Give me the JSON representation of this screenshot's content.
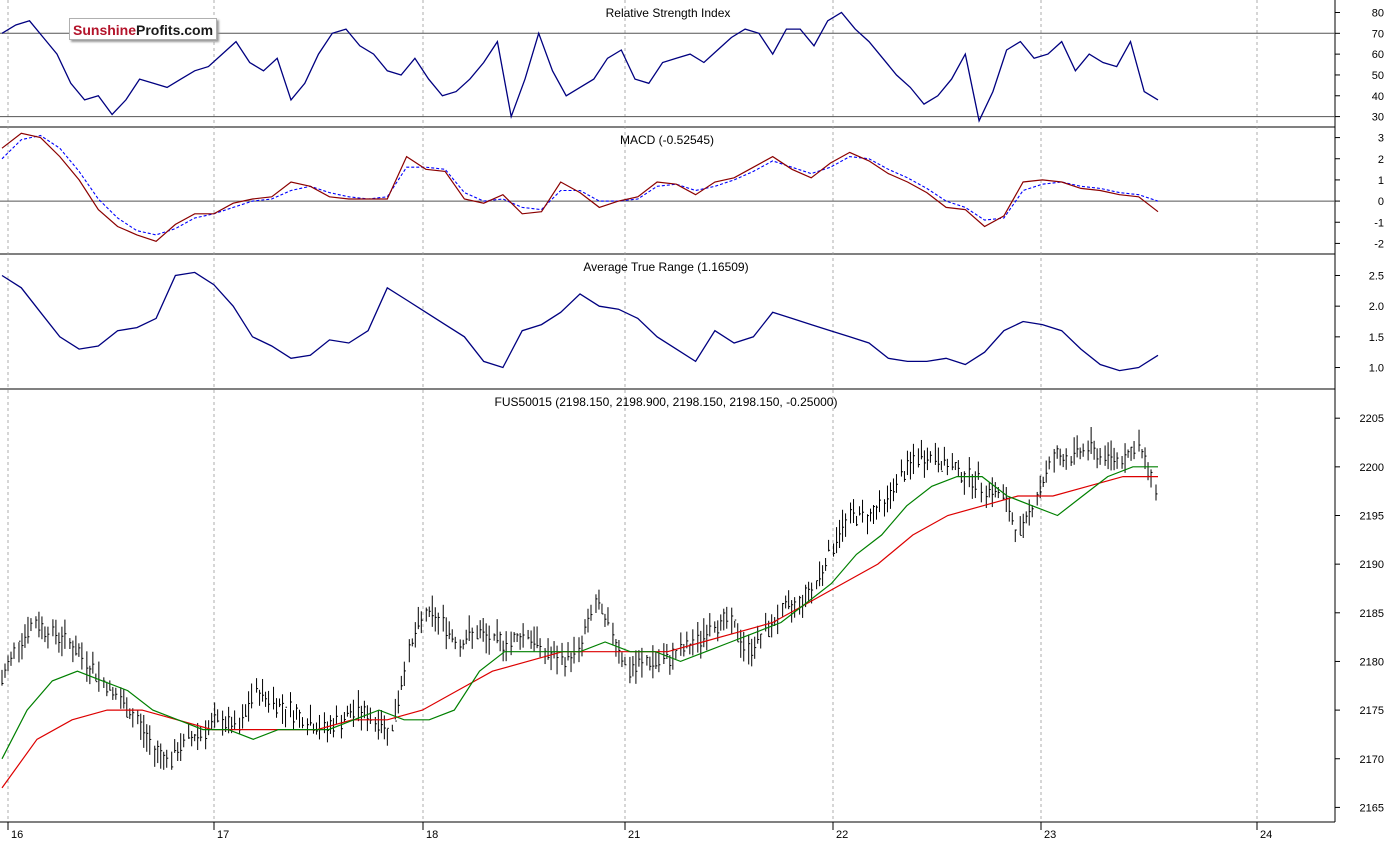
{
  "logo": {
    "part1": "Sunshine",
    "part2": "Profits.com"
  },
  "colors": {
    "rsi": "#000080",
    "macd": "#8b0000",
    "signal": "#0000ff",
    "atr": "#000080",
    "sma_fast": "#008000",
    "sma_slow": "#dd0000",
    "grid": "#999999",
    "bars": "#000000"
  },
  "chart_data": [
    {
      "type": "line",
      "title": "Relative Strength Index",
      "ylim": [
        25,
        86
      ],
      "yticks": [
        30,
        40,
        50,
        60,
        70,
        80
      ],
      "reference_lines": [
        30,
        70
      ],
      "x": [
        0,
        2,
        4,
        6,
        8,
        10,
        12,
        14,
        16,
        18,
        20,
        22,
        24,
        26,
        28,
        30,
        32,
        34,
        36,
        38,
        40,
        42,
        44,
        46,
        48,
        50,
        52,
        54,
        56,
        58,
        60,
        62,
        64,
        66,
        68,
        70,
        72,
        74,
        76,
        78,
        80,
        82,
        84,
        86,
        88,
        90,
        92,
        94,
        96,
        98,
        100,
        102,
        104,
        106,
        108,
        110,
        112,
        114,
        116,
        118,
        120,
        122,
        124,
        126,
        128,
        130,
        132,
        134,
        136,
        138
      ],
      "series": [
        {
          "values": [
            70,
            74,
            76,
            68,
            60,
            46,
            38,
            40,
            31,
            38,
            48,
            46,
            44,
            48,
            52,
            54,
            60,
            66,
            56,
            52,
            58,
            38,
            46,
            60,
            70,
            72,
            64,
            60,
            52,
            50,
            58,
            48,
            40,
            42,
            48,
            56,
            66,
            30,
            48,
            70,
            52,
            40,
            44,
            48,
            58,
            62,
            48,
            46,
            56,
            58,
            60,
            56,
            62,
            68,
            72,
            70,
            60,
            72,
            72,
            64,
            76,
            80,
            72,
            66,
            58,
            50,
            44,
            36,
            40,
            48,
            60,
            28,
            42,
            62,
            66,
            58,
            60,
            66,
            52,
            60,
            56,
            54,
            66,
            42,
            38
          ]
        }
      ]
    },
    {
      "type": "line",
      "title": "MACD (-0.52545)",
      "ylim": [
        -2.5,
        3.5
      ],
      "yticks": [
        -2,
        -1,
        0,
        1,
        2,
        3
      ],
      "reference_lines": [
        0
      ],
      "x": [
        0,
        2,
        4,
        6,
        8,
        10,
        12,
        14,
        16,
        18,
        20,
        22,
        24,
        26,
        28,
        30,
        32,
        34,
        36,
        38,
        40,
        42,
        44,
        46,
        48,
        50,
        52,
        54,
        56,
        58,
        60,
        62,
        64,
        66,
        68,
        70,
        72,
        74,
        76,
        78,
        80,
        82,
        84,
        86,
        88,
        90,
        92,
        94,
        96,
        98,
        100,
        102,
        104,
        106,
        108,
        110,
        112,
        114,
        116,
        118,
        120,
        122,
        124,
        126,
        128,
        130,
        132,
        134,
        136,
        138
      ],
      "series": [
        {
          "values": [
            2.5,
            3.2,
            3.0,
            2.1,
            1.0,
            -0.4,
            -1.2,
            -1.6,
            -1.9,
            -1.1,
            -0.6,
            -0.6,
            -0.1,
            0.1,
            0.2,
            0.9,
            0.7,
            0.2,
            0.1,
            0.1,
            0.1,
            2.1,
            1.5,
            1.4,
            0.1,
            -0.1,
            0.3,
            -0.6,
            -0.5,
            0.9,
            0.4,
            -0.3,
            0.0,
            0.2,
            0.9,
            0.8,
            0.3,
            0.9,
            1.1,
            1.6,
            2.1,
            1.5,
            1.1,
            1.8,
            2.3,
            1.9,
            1.3,
            0.9,
            0.4,
            -0.3,
            -0.4,
            -1.2,
            -0.7,
            0.9,
            1.0,
            0.9,
            0.6,
            0.5,
            0.3,
            0.2,
            -0.5
          ]
        },
        {
          "values": [
            2.0,
            2.9,
            3.1,
            2.5,
            1.4,
            0.1,
            -0.8,
            -1.4,
            -1.6,
            -1.3,
            -0.8,
            -0.6,
            -0.3,
            0.0,
            0.1,
            0.5,
            0.7,
            0.4,
            0.2,
            0.1,
            0.2,
            1.6,
            1.6,
            1.5,
            0.4,
            0.0,
            0.1,
            -0.3,
            -0.4,
            0.5,
            0.5,
            0.0,
            0.0,
            0.1,
            0.7,
            0.8,
            0.5,
            0.7,
            1.0,
            1.4,
            1.9,
            1.6,
            1.3,
            1.6,
            2.1,
            2.0,
            1.5,
            1.1,
            0.6,
            0.0,
            -0.3,
            -0.9,
            -0.8,
            0.5,
            0.8,
            0.9,
            0.7,
            0.6,
            0.4,
            0.3,
            0.0
          ]
        }
      ]
    },
    {
      "type": "line",
      "title": "Average True Range (1.16509)",
      "ylim": [
        0.65,
        2.85
      ],
      "yticks": [
        1.0,
        1.5,
        2.0,
        2.5
      ],
      "series": [
        {
          "values": [
            2.5,
            2.3,
            1.9,
            1.5,
            1.3,
            1.35,
            1.6,
            1.65,
            1.8,
            2.5,
            2.55,
            2.35,
            2.0,
            1.5,
            1.35,
            1.15,
            1.2,
            1.45,
            1.4,
            1.6,
            2.3,
            2.1,
            1.9,
            1.7,
            1.5,
            1.1,
            1.0,
            1.6,
            1.7,
            1.9,
            2.2,
            2.0,
            1.95,
            1.8,
            1.5,
            1.3,
            1.1,
            1.6,
            1.4,
            1.5,
            1.9,
            1.8,
            1.7,
            1.6,
            1.5,
            1.4,
            1.15,
            1.1,
            1.1,
            1.15,
            1.05,
            1.25,
            1.6,
            1.75,
            1.7,
            1.6,
            1.3,
            1.05,
            0.95,
            1.0,
            1.2
          ]
        }
      ]
    },
    {
      "type": "line",
      "title": "FUS50015 (2198.150, 2198.900, 2198.150, 2198.150, -0.25000)",
      "ylim": [
        2163.5,
        2208
      ],
      "yticks": [
        2165,
        2170,
        2175,
        2180,
        2185,
        2190,
        2195,
        2200,
        2205
      ],
      "xlabels": [
        "16",
        "17",
        "18",
        "21",
        "22",
        "23",
        "24"
      ],
      "series": [
        {
          "values": [
            2178,
            2182,
            2184,
            2183,
            2182,
            2180,
            2178,
            2176,
            2174,
            2171,
            2170,
            2172,
            2173,
            2174,
            2173,
            2177,
            2176,
            2175,
            2174,
            2173,
            2174,
            2175,
            2174,
            2173,
            2181,
            2185,
            2184,
            2182,
            2183,
            2182,
            2182,
            2183,
            2181,
            2180,
            2181,
            2186,
            2183,
            2179,
            2180,
            2180,
            2181,
            2182,
            2184,
            2184,
            2181,
            2183,
            2185,
            2186,
            2188,
            2192,
            2195,
            2195,
            2196,
            2199,
            2201,
            2201,
            2200,
            2199,
            2198,
            2197,
            2193,
            2197,
            2201,
            2201,
            2202,
            2201,
            2201,
            2202,
            2198
          ]
        },
        {
          "values": [
            2170,
            2175,
            2178,
            2179,
            2178,
            2177,
            2175,
            2174,
            2173,
            2173,
            2172,
            2173,
            2173,
            2173,
            2174,
            2175,
            2174,
            2174,
            2175,
            2179,
            2181,
            2181,
            2181,
            2181,
            2182,
            2181,
            2181,
            2180,
            2181,
            2182,
            2183,
            2184,
            2186,
            2188,
            2191,
            2193,
            2196,
            2198,
            2199,
            2199,
            2197,
            2196,
            2195,
            2197,
            2199,
            2200,
            2200
          ]
        },
        {
          "values": [
            2167,
            2172,
            2174,
            2175,
            2175,
            2174,
            2173,
            2173,
            2173,
            2173,
            2174,
            2174,
            2175,
            2177,
            2179,
            2180,
            2181,
            2181,
            2181,
            2181,
            2182,
            2183,
            2184,
            2186,
            2188,
            2190,
            2193,
            2195,
            2196,
            2197,
            2197,
            2198,
            2199,
            2199
          ]
        }
      ]
    }
  ]
}
